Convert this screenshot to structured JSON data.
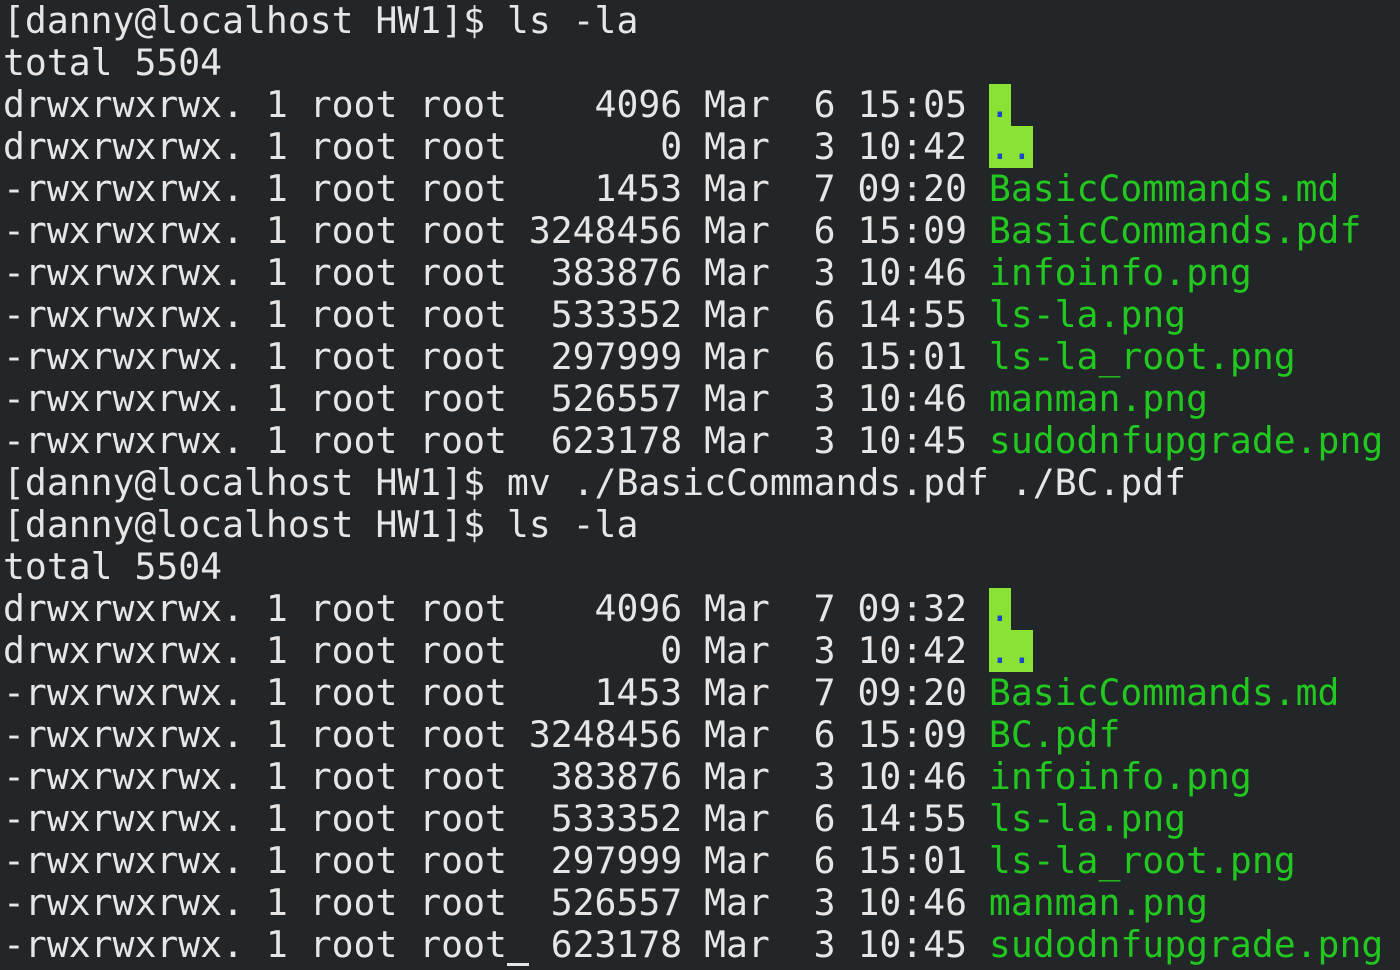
{
  "colors": {
    "background": "#232629",
    "text": "#e6e6e6",
    "file": "#22c81f",
    "dir_bg": "#8ae234",
    "dir_fg": "#1a48c8"
  },
  "lines": [
    {
      "type": "prompt",
      "text": "[danny@localhost HW1]$ ls -la"
    },
    {
      "type": "text",
      "text": "total 5504"
    },
    {
      "type": "entry",
      "meta": "drwxrwxrwx. 1 root root    4096 Mar  6 15:05 ",
      "name": ".",
      "kind": "dir"
    },
    {
      "type": "entry",
      "meta": "drwxrwxrwx. 1 root root       0 Mar  3 10:42 ",
      "name": "..",
      "kind": "dir"
    },
    {
      "type": "entry",
      "meta": "-rwxrwxrwx. 1 root root    1453 Mar  7 09:20 ",
      "name": "BasicCommands.md",
      "kind": "file"
    },
    {
      "type": "entry",
      "meta": "-rwxrwxrwx. 1 root root 3248456 Mar  6 15:09 ",
      "name": "BasicCommands.pdf",
      "kind": "file"
    },
    {
      "type": "entry",
      "meta": "-rwxrwxrwx. 1 root root  383876 Mar  3 10:46 ",
      "name": "infoinfo.png",
      "kind": "file"
    },
    {
      "type": "entry",
      "meta": "-rwxrwxrwx. 1 root root  533352 Mar  6 14:55 ",
      "name": "ls-la.png",
      "kind": "file"
    },
    {
      "type": "entry",
      "meta": "-rwxrwxrwx. 1 root root  297999 Mar  6 15:01 ",
      "name": "ls-la_root.png",
      "kind": "file"
    },
    {
      "type": "entry",
      "meta": "-rwxrwxrwx. 1 root root  526557 Mar  3 10:46 ",
      "name": "manman.png",
      "kind": "file"
    },
    {
      "type": "entry",
      "meta": "-rwxrwxrwx. 1 root root  623178 Mar  3 10:45 ",
      "name": "sudodnfupgrade.png",
      "kind": "file"
    },
    {
      "type": "prompt",
      "text": "[danny@localhost HW1]$ mv ./BasicCommands.pdf ./BC.pdf"
    },
    {
      "type": "prompt",
      "text": "[danny@localhost HW1]$ ls -la"
    },
    {
      "type": "text",
      "text": "total 5504"
    },
    {
      "type": "entry",
      "meta": "drwxrwxrwx. 1 root root    4096 Mar  7 09:32 ",
      "name": ".",
      "kind": "dir"
    },
    {
      "type": "entry",
      "meta": "drwxrwxrwx. 1 root root       0 Mar  3 10:42 ",
      "name": "..",
      "kind": "dir"
    },
    {
      "type": "entry",
      "meta": "-rwxrwxrwx. 1 root root    1453 Mar  7 09:20 ",
      "name": "BasicCommands.md",
      "kind": "file"
    },
    {
      "type": "entry",
      "meta": "-rwxrwxrwx. 1 root root 3248456 Mar  6 15:09 ",
      "name": "BC.pdf",
      "kind": "file"
    },
    {
      "type": "entry",
      "meta": "-rwxrwxrwx. 1 root root  383876 Mar  3 10:46 ",
      "name": "infoinfo.png",
      "kind": "file"
    },
    {
      "type": "entry",
      "meta": "-rwxrwxrwx. 1 root root  533352 Mar  6 14:55 ",
      "name": "ls-la.png",
      "kind": "file"
    },
    {
      "type": "entry",
      "meta": "-rwxrwxrwx. 1 root root  297999 Mar  6 15:01 ",
      "name": "ls-la_root.png",
      "kind": "file"
    },
    {
      "type": "entry",
      "meta": "-rwxrwxrwx. 1 root root  526557 Mar  3 10:46 ",
      "name": "manman.png",
      "kind": "file"
    },
    {
      "type": "entry",
      "meta": "-rwxrwxrwx. 1 root root  623178 Mar  3 10:45 ",
      "name": "sudodnfupgrade.png",
      "kind": "file",
      "cursor": true
    }
  ]
}
